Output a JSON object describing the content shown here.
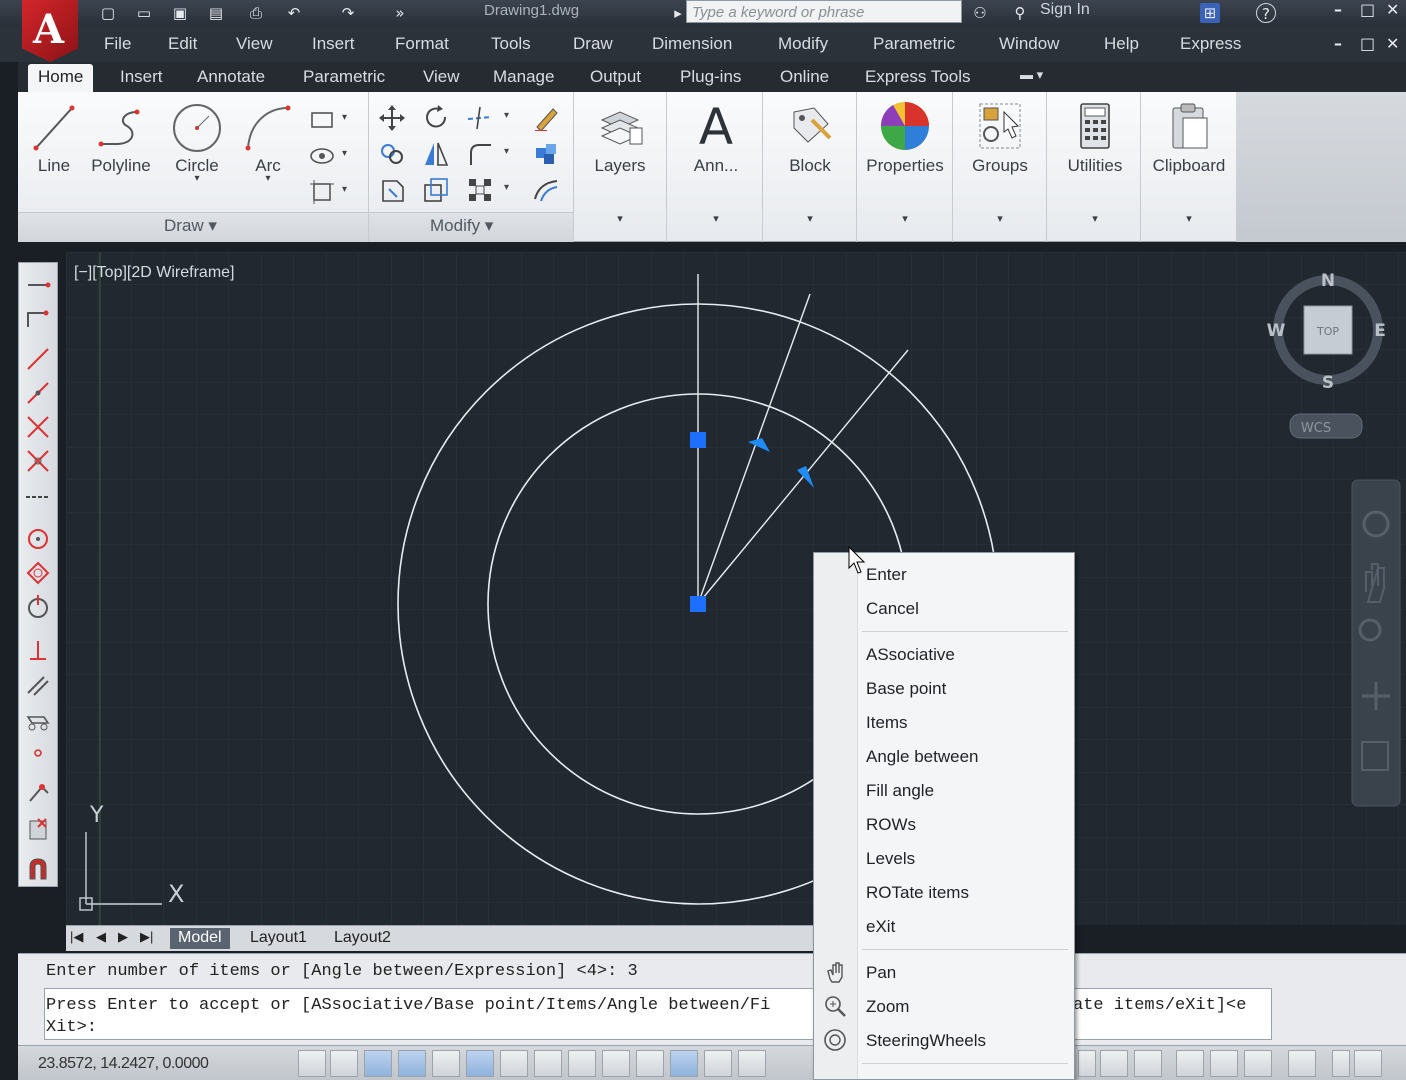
{
  "titlebar": {
    "app_letter": "A",
    "doc_title": "Drawing1.dwg",
    "search_placeholder": "Type a keyword or phrase",
    "signin": "Sign In",
    "help": "?",
    "min": "–",
    "max": "□",
    "close": "✕"
  },
  "menu": [
    "File",
    "Edit",
    "View",
    "Insert",
    "Format",
    "Tools",
    "Draw",
    "Dimension",
    "Modify",
    "Parametric",
    "Window",
    "Help",
    "Express"
  ],
  "ribbon_tabs": [
    "Home",
    "Insert",
    "Annotate",
    "Parametric",
    "View",
    "Manage",
    "Output",
    "Plug-ins",
    "Online",
    "Express Tools"
  ],
  "draw_tools": [
    "Line",
    "Polyline",
    "Circle",
    "Arc"
  ],
  "panels": {
    "draw": "Draw",
    "modify": "Modify"
  },
  "big_tools": [
    "Layers",
    "Ann...",
    "Block",
    "Properties",
    "Groups",
    "Utilities",
    "Clipboard"
  ],
  "viewport": {
    "label": "[−][Top][2D Wireframe]",
    "compass": {
      "n": "N",
      "s": "S",
      "e": "E",
      "w": "W",
      "top": "TOP"
    },
    "wcs": "WCS",
    "ucs_x": "X",
    "ucs_y": "Y"
  },
  "layout_tabs": [
    "Model",
    "Layout1",
    "Layout2"
  ],
  "command": {
    "history": "Enter number of items or [Angle between/Expression] <4>: 3",
    "prompt1": "Press Enter to accept or [ASsociative/Base point/Items/Angle between/Fi",
    "prompt1_end": "ate items/eXit]<e",
    "prompt2": "Xit>:"
  },
  "status": {
    "coords": "23.8572, 14.2427, 0.0000"
  },
  "context_menu": {
    "group1": [
      "Enter",
      "Cancel"
    ],
    "group2": [
      "ASsociative",
      "Base point",
      "Items",
      "Angle between",
      "Fill angle",
      "ROWs",
      "Levels",
      "ROTate items",
      "eXit"
    ],
    "group3": [
      "Pan",
      "Zoom",
      "SteeringWheels"
    ],
    "icons": {
      "pan": "pan-hand-icon",
      "zoom": "zoom-magnifier-icon",
      "steering": "steering-wheel-icon"
    }
  },
  "colors": {
    "grip": "#1e6fff",
    "arrow": "#1e8cff",
    "geometry": "#e8ecf0",
    "canvas": "#212830"
  }
}
